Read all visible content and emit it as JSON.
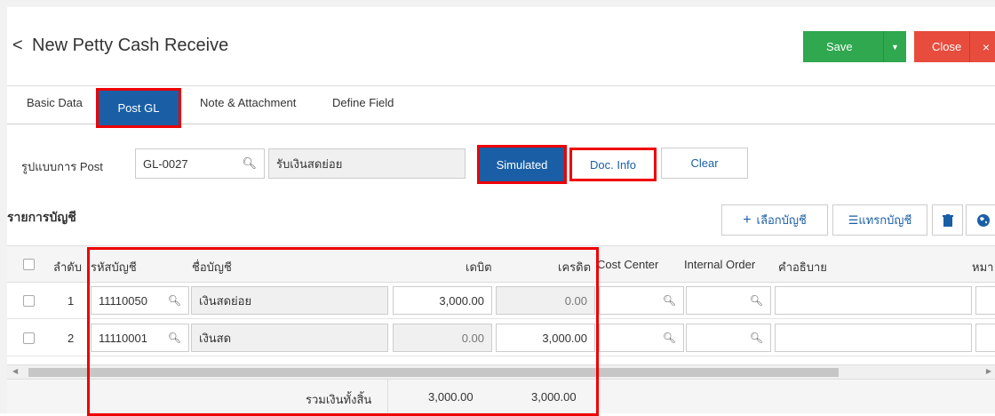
{
  "header": {
    "back_glyph": "<",
    "title": "New Petty Cash Receive",
    "save_label": "Save",
    "close_label": "Close",
    "close_x": "×"
  },
  "tabs": [
    {
      "label": "Basic Data",
      "active": false
    },
    {
      "label": "Post GL",
      "active": true
    },
    {
      "label": "Note & Attachment",
      "active": false
    },
    {
      "label": "Define Field",
      "active": false
    }
  ],
  "form": {
    "post_format_label": "รูปแบบการ Post",
    "post_code": "GL-0027",
    "post_name": "รับเงินสดย่อย",
    "simulated_label": "Simulated",
    "doc_info_label": "Doc. Info",
    "clear_label": "Clear"
  },
  "accounts": {
    "section_title": "รายการบัญชี",
    "select_account_label": "เลือกบัญชี",
    "insert_account_label": "แทรกบัญชี",
    "columns": {
      "seq": "ลำดับ",
      "account_code": "รหัสบัญชี",
      "account_name": "ชื่อบัญชี",
      "debit": "เดบิต",
      "credit": "เครดิต",
      "cost_center": "Cost Center",
      "internal_order": "Internal Order",
      "description": "คำอธิบาย",
      "note_partial": "หมา"
    },
    "rows": [
      {
        "seq": "1",
        "code": "11110050",
        "name": "เงินสดย่อย",
        "debit": "3,000.00",
        "credit": "0.00"
      },
      {
        "seq": "2",
        "code": "11110001",
        "name": "เงินสด",
        "debit": "0.00",
        "credit": "3,000.00"
      }
    ],
    "total_label": "รวมเงินทั้งสิ้น",
    "total_debit": "3,000.00",
    "total_credit": "3,000.00"
  },
  "colors": {
    "primary": "#1a5fa5",
    "save": "#2fa84f",
    "close": "#e74c3c",
    "highlight": "#e00000"
  }
}
